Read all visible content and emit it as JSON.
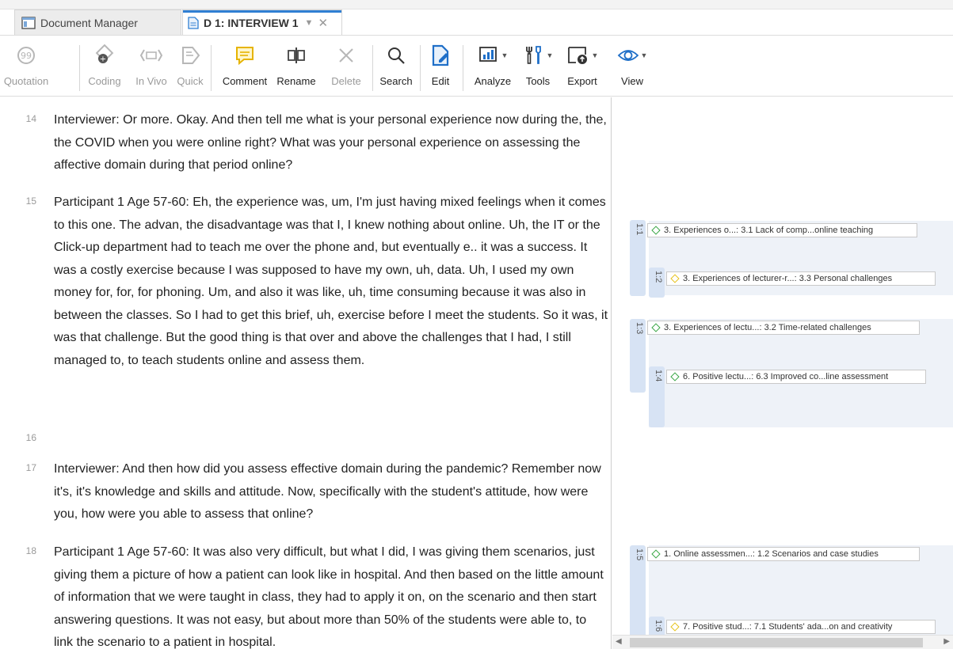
{
  "tabs": [
    {
      "label": "Document Manager",
      "icon": "document-manager-icon"
    },
    {
      "label": "D 1: INTERVIEW 1",
      "icon": "document-icon"
    }
  ],
  "toolbar": {
    "quotation": "Quotation",
    "coding": "Coding",
    "invivo": "In Vivo",
    "quick": "Quick",
    "comment": "Comment",
    "rename": "Rename",
    "delete": "Delete",
    "search": "Search",
    "edit": "Edit",
    "analyze": "Analyze",
    "tools": "Tools",
    "export": "Export",
    "view": "View"
  },
  "paragraphs": [
    {
      "num": "14",
      "text": "Interviewer: Or more. Okay. And then tell me what is your personal experience now during the, the, the COVID when you were online right? What was your personal experience on assessing the affective domain during that period online?"
    },
    {
      "num": "15",
      "text": "Participant 1 Age 57-60: Eh, the experience was, um, I'm just having mixed feelings when it comes to this one. The advan, the disadvantage was that I, I knew nothing about online. Uh, the IT or the Click-up department had to teach me over the phone and, but eventually e.. it was a success. It was a costly exercise because I was supposed to have my own, uh, data. Uh, I used my own money for, for, for phoning. Um, and also it was like, uh, time consuming because it was also in between the classes. So I had to get this brief, uh, exercise before I meet the students. So it was, it was that challenge. But the good thing is that over and above the challenges that I had, I still managed to, to teach students online and assess them."
    },
    {
      "num": "16",
      "text": ""
    },
    {
      "num": "17",
      "text": "Interviewer: And then how did you assess effective domain during the pandemic? Remember now it's, it's knowledge and skills and attitude. Now, specifically with the student's attitude, how were you, how were you able to assess that online?"
    },
    {
      "num": "18",
      "text": "Participant 1 Age 57-60: It was also very difficult, but what I did, I was giving them scenarios, just giving them a picture of how a patient can look like in hospital. And then based on the little amount of information that we were taught in class, they had to apply it on, on the scenario and then start answering questions. It was not easy, but about more than 50% of the students were able to, to link the scenario to a patient in hospital."
    }
  ],
  "quotations": [
    {
      "id": "1:1",
      "code": "3. Experiences o...: 3.1 Lack of comp...online teaching",
      "kind": "normal"
    },
    {
      "id": "1:2",
      "code": "3. Experiences of lecturer-r...: 3.3 Personal challenges",
      "kind": "lightning"
    },
    {
      "id": "1:3",
      "code": "3. Experiences of lectu...: 3.2 Time-related challenges",
      "kind": "normal"
    },
    {
      "id": "1:4",
      "code": "6. Positive lectu...: 6.3 Improved co...line assessment",
      "kind": "normal"
    },
    {
      "id": "1:5",
      "code": "1. Online assessmen...: 1.2 Scenarios and case studies",
      "kind": "normal"
    },
    {
      "id": "1:6",
      "code": "7. Positive stud...: 7.1 Students' ada...on and creativity",
      "kind": "lightning"
    }
  ],
  "colors": {
    "accent": "#2f7fd3",
    "code_green": "#3aa645",
    "code_yellow": "#e6c21b",
    "quote_bar": "#d7e3f4"
  }
}
